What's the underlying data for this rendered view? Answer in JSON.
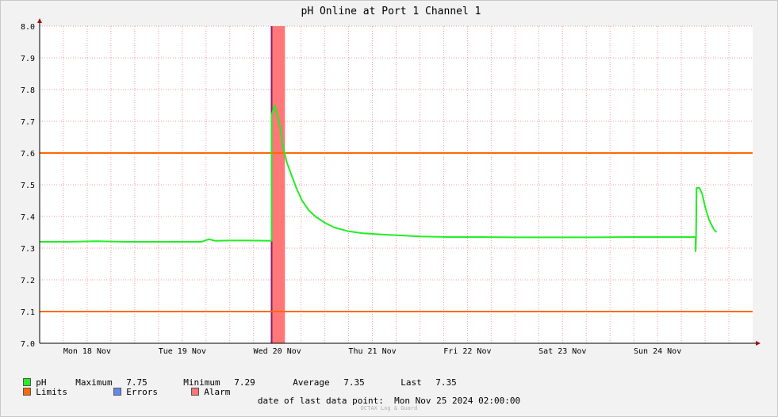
{
  "chart_data": {
    "type": "line",
    "title": "pH Online at Port 1 Channel 1",
    "ylim": [
      7.0,
      8.0
    ],
    "yticks": [
      "7.0",
      "7.1",
      "7.2",
      "7.3",
      "7.4",
      "7.5",
      "7.6",
      "7.7",
      "7.8",
      "7.9",
      "8.0"
    ],
    "xlim": [
      0,
      7.5
    ],
    "xticks": [
      {
        "label": "Mon 18 Nov",
        "pos": 0.5
      },
      {
        "label": "Tue 19 Nov",
        "pos": 1.5
      },
      {
        "label": "Wed 20 Nov",
        "pos": 2.5
      },
      {
        "label": "Thu 21 Nov",
        "pos": 3.5
      },
      {
        "label": "Fri 22 Nov",
        "pos": 4.5
      },
      {
        "label": "Sat 23 Nov",
        "pos": 5.5
      },
      {
        "label": "Sun 24 Nov",
        "pos": 6.5
      }
    ],
    "limits": {
      "upper": 7.6,
      "lower": 7.1
    },
    "alarm_band": [
      2.44,
      2.58
    ],
    "error_marker": 2.44,
    "series": [
      {
        "name": "pH",
        "color": "#22ee22",
        "points": [
          [
            0,
            7.32
          ],
          [
            0.3,
            7.32
          ],
          [
            0.6,
            7.322
          ],
          [
            0.9,
            7.32
          ],
          [
            1.2,
            7.32
          ],
          [
            1.5,
            7.32
          ],
          [
            1.7,
            7.32
          ],
          [
            1.78,
            7.328
          ],
          [
            1.85,
            7.323
          ],
          [
            2.0,
            7.324
          ],
          [
            2.2,
            7.324
          ],
          [
            2.44,
            7.323
          ],
          [
            2.44,
            7.72
          ],
          [
            2.47,
            7.75
          ],
          [
            2.5,
            7.72
          ],
          [
            2.53,
            7.68
          ],
          [
            2.56,
            7.62
          ],
          [
            2.6,
            7.57
          ],
          [
            2.65,
            7.53
          ],
          [
            2.7,
            7.49
          ],
          [
            2.76,
            7.45
          ],
          [
            2.83,
            7.42
          ],
          [
            2.9,
            7.4
          ],
          [
            3.0,
            7.38
          ],
          [
            3.1,
            7.365
          ],
          [
            3.25,
            7.353
          ],
          [
            3.4,
            7.347
          ],
          [
            3.6,
            7.343
          ],
          [
            3.8,
            7.34
          ],
          [
            4.0,
            7.337
          ],
          [
            4.3,
            7.335
          ],
          [
            4.6,
            7.335
          ],
          [
            5.0,
            7.334
          ],
          [
            5.4,
            7.334
          ],
          [
            5.8,
            7.334
          ],
          [
            6.2,
            7.335
          ],
          [
            6.6,
            7.335
          ],
          [
            6.9,
            7.335
          ],
          [
            6.9,
            7.29
          ],
          [
            6.905,
            7.335
          ],
          [
            6.91,
            7.49
          ],
          [
            6.94,
            7.49
          ],
          [
            6.97,
            7.47
          ],
          [
            7.0,
            7.43
          ],
          [
            7.04,
            7.39
          ],
          [
            7.09,
            7.36
          ],
          [
            7.12,
            7.35
          ]
        ]
      }
    ]
  },
  "legend": {
    "ph_label": "pH",
    "max_label": "Maximum",
    "max_value": "7.75",
    "min_label": "Minimum",
    "min_value": "7.29",
    "avg_label": "Average",
    "avg_value": "7.35",
    "last_label": "Last",
    "last_value": "7.35",
    "limits_label": "Limits",
    "errors_label": "Errors",
    "alarm_label": "Alarm",
    "colors": {
      "ph": "#22ee22",
      "limits": "#ff6a00",
      "errors": "#6688ee",
      "alarm": "#ff7777"
    }
  },
  "footer": {
    "date_label": "date of last data point:",
    "date_value": "Mon Nov 25 2024 02:00:00",
    "brand": "OCTAX Log & Guard"
  }
}
